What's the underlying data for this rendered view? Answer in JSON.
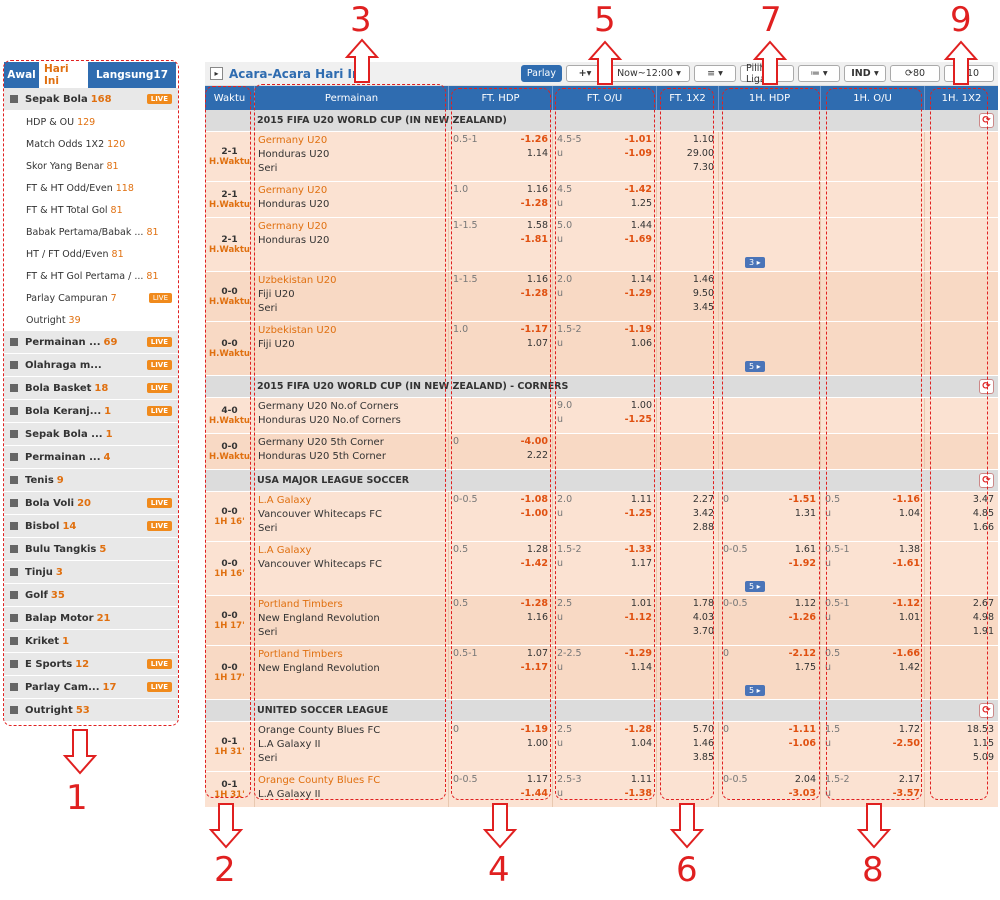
{
  "left": {
    "tabs": [
      {
        "label": "Awal",
        "active": false
      },
      {
        "label": "Hari Ini",
        "active": true
      },
      {
        "label": "Langsung",
        "count": "17",
        "active": false
      }
    ],
    "sports": [
      {
        "label": "Sepak Bola",
        "count": "168",
        "live": true,
        "subs": [
          {
            "label": "HDP & OU",
            "count": "129"
          },
          {
            "label": "Match Odds 1X2",
            "count": "120"
          },
          {
            "label": "Skor Yang Benar",
            "count": "81"
          },
          {
            "label": "FT & HT Odd/Even",
            "count": "118"
          },
          {
            "label": "FT & HT Total Gol",
            "count": "81"
          },
          {
            "label": "Babak Pertama/Babak ...",
            "count": "81"
          },
          {
            "label": "HT / FT Odd/Even",
            "count": "81"
          },
          {
            "label": "FT & HT Gol Pertama / ...",
            "count": "81"
          },
          {
            "label": "Parlay Campuran",
            "count": "7",
            "live": true
          },
          {
            "label": "Outright",
            "count": "39"
          }
        ]
      },
      {
        "label": "Permainan ...",
        "count": "69",
        "live": true
      },
      {
        "label": "Olahraga m...",
        "count": "",
        "live": true
      },
      {
        "label": "Bola Basket",
        "count": "18",
        "live": true
      },
      {
        "label": "Bola Keranj...",
        "count": "1",
        "live": true
      },
      {
        "label": "Sepak Bola ...",
        "count": "1"
      },
      {
        "label": "Permainan ...",
        "count": "4"
      },
      {
        "label": "Tenis",
        "count": "9"
      },
      {
        "label": "Bola Voli",
        "count": "20",
        "live": true
      },
      {
        "label": "Bisbol",
        "count": "14",
        "live": true
      },
      {
        "label": "Bulu Tangkis",
        "count": "5"
      },
      {
        "label": "Tinju",
        "count": "3"
      },
      {
        "label": "Golf",
        "count": "35"
      },
      {
        "label": "Balap Motor",
        "count": "21"
      },
      {
        "label": "Kriket",
        "count": "1"
      },
      {
        "label": "E Sports",
        "count": "12",
        "live": true
      },
      {
        "label": "Parlay Cam...",
        "count": "17",
        "live": true
      },
      {
        "label": "Outright",
        "count": "53"
      }
    ],
    "live_label": "LIVE"
  },
  "main": {
    "title": "Acara-Acara Hari Ini",
    "toolbar": {
      "parlay": "Parlay",
      "add": "+",
      "time": "Now~12:00",
      "sort": "≡",
      "pick_league": "Pilih Liga",
      "view": "≔",
      "odds_type": "IND",
      "refresh_a": "80",
      "refresh_b": "10"
    },
    "headers": [
      "Waktu",
      "Permainan",
      "FT. HDP",
      "FT. O/U",
      "FT. 1X2",
      "1H. HDP",
      "1H. O/U",
      "1H. 1X2"
    ],
    "leagues": [
      {
        "name": "2015 FIFA U20 WORLD CUP (IN NEW ZEALAND)",
        "matches": [
          {
            "alt": false,
            "score": "2-1",
            "time": "H.Waktu",
            "teams": [
              "Germany U20",
              "Honduras U20",
              "Seri"
            ],
            "fav": 0,
            "fthdp": [
              [
                "0.5-1",
                "-1.26"
              ],
              [
                "",
                "1.14"
              ]
            ],
            "ftou": [
              [
                "4.5-5",
                "-1.01"
              ],
              [
                "u",
                "-1.09"
              ]
            ],
            "ft1x2": [
              "1.10",
              "29.00",
              "7.30"
            ]
          },
          {
            "alt": false,
            "score": "2-1",
            "time": "H.Waktu",
            "teams": [
              "Germany U20",
              "Honduras U20"
            ],
            "fav": 0,
            "fthdp": [
              [
                "1.0",
                "1.16"
              ],
              [
                "",
                "-1.28"
              ]
            ],
            "ftou": [
              [
                "4.5",
                "-1.42"
              ],
              [
                "u",
                "1.25"
              ]
            ]
          },
          {
            "alt": false,
            "score": "2-1",
            "time": "H.Waktu",
            "teams": [
              "Germany U20",
              "Honduras U20"
            ],
            "fav": 0,
            "fthdp": [
              [
                "1-1.5",
                "1.58"
              ],
              [
                "",
                "-1.81"
              ]
            ],
            "ftou": [
              [
                "5.0",
                "1.44"
              ],
              [
                "u",
                "-1.69"
              ]
            ],
            "more": "3"
          },
          {
            "alt": true,
            "score": "0-0",
            "time": "H.Waktu",
            "teams": [
              "Uzbekistan U20",
              "Fiji U20",
              "Seri"
            ],
            "fav": 0,
            "fthdp": [
              [
                "1-1.5",
                "1.16"
              ],
              [
                "",
                "-1.28"
              ]
            ],
            "ftou": [
              [
                "2.0",
                "1.14"
              ],
              [
                "u",
                "-1.29"
              ]
            ],
            "ft1x2": [
              "1.46",
              "9.50",
              "3.45"
            ]
          },
          {
            "alt": true,
            "score": "0-0",
            "time": "H.Waktu",
            "teams": [
              "Uzbekistan U20",
              "Fiji U20"
            ],
            "fav": 0,
            "fthdp": [
              [
                "1.0",
                "-1.17"
              ],
              [
                "",
                "1.07"
              ]
            ],
            "ftou": [
              [
                "1.5-2",
                "-1.19"
              ],
              [
                "u",
                "1.06"
              ]
            ],
            "more": "5"
          }
        ]
      },
      {
        "name": "2015 FIFA U20 WORLD CUP (IN NEW ZEALAND) - CORNERS",
        "matches": [
          {
            "alt": false,
            "score": "4-0",
            "time": "H.Waktu",
            "teams": [
              "Germany U20 No.of Corners",
              "Honduras U20 No.of Corners"
            ],
            "fav": -1,
            "fthdp": [],
            "ftou": [
              [
                "9.0",
                "1.00"
              ],
              [
                "u",
                "-1.25"
              ]
            ]
          },
          {
            "alt": true,
            "score": "0-0",
            "time": "H.Waktu",
            "teams": [
              "Germany U20 5th Corner",
              "Honduras U20 5th Corner"
            ],
            "fav": -1,
            "fthdp": [
              [
                "0",
                "-4.00"
              ],
              [
                "",
                "2.22"
              ]
            ],
            "ftou": []
          }
        ]
      },
      {
        "name": "USA MAJOR LEAGUE SOCCER",
        "matches": [
          {
            "alt": false,
            "score": "0-0",
            "time": "1H 16'",
            "teams": [
              "L.A Galaxy",
              "Vancouver Whitecaps FC",
              "Seri"
            ],
            "fav": 0,
            "fthdp": [
              [
                "0-0.5",
                "-1.08"
              ],
              [
                "",
                "-1.00"
              ]
            ],
            "ftou": [
              [
                "2.0",
                "1.11"
              ],
              [
                "u",
                "-1.25"
              ]
            ],
            "ft1x2": [
              "2.27",
              "3.42",
              "2.88"
            ],
            "hhdp": [
              [
                "0",
                "-1.51"
              ],
              [
                "",
                "1.31"
              ]
            ],
            "hou": [
              [
                "0.5",
                "-1.16"
              ],
              [
                "u",
                "1.04"
              ]
            ],
            "h1x2": [
              "3.47",
              "4.85",
              "1.66"
            ]
          },
          {
            "alt": false,
            "score": "0-0",
            "time": "1H 16'",
            "teams": [
              "L.A Galaxy",
              "Vancouver Whitecaps FC"
            ],
            "fav": 0,
            "fthdp": [
              [
                "0.5",
                "1.28"
              ],
              [
                "",
                "-1.42"
              ]
            ],
            "ftou": [
              [
                "1.5-2",
                "-1.33"
              ],
              [
                "u",
                "1.17"
              ]
            ],
            "hhdp": [
              [
                "0-0.5",
                "1.61"
              ],
              [
                "",
                "-1.92"
              ]
            ],
            "hou": [
              [
                "0.5-1",
                "1.38"
              ],
              [
                "u",
                "-1.61"
              ]
            ],
            "more": "5"
          },
          {
            "alt": true,
            "score": "0-0",
            "time": "1H 17'",
            "teams": [
              "Portland Timbers",
              "New England Revolution",
              "Seri"
            ],
            "fav": 0,
            "fthdp": [
              [
                "0.5",
                "-1.28"
              ],
              [
                "",
                "1.16"
              ]
            ],
            "ftou": [
              [
                "2.5",
                "1.01"
              ],
              [
                "u",
                "-1.12"
              ]
            ],
            "ft1x2": [
              "1.78",
              "4.03",
              "3.70"
            ],
            "hhdp": [
              [
                "0-0.5",
                "1.12"
              ],
              [
                "",
                "-1.26"
              ]
            ],
            "hou": [
              [
                "0.5-1",
                "-1.12"
              ],
              [
                "u",
                "1.01"
              ]
            ],
            "h1x2": [
              "2.67",
              "4.98",
              "1.91"
            ]
          },
          {
            "alt": true,
            "score": "0-0",
            "time": "1H 17'",
            "teams": [
              "Portland Timbers",
              "New England Revolution"
            ],
            "fav": 0,
            "fthdp": [
              [
                "0.5-1",
                "1.07"
              ],
              [
                "",
                "-1.17"
              ]
            ],
            "ftou": [
              [
                "2-2.5",
                "-1.29"
              ],
              [
                "u",
                "1.14"
              ]
            ],
            "hhdp": [
              [
                "0",
                "-2.12"
              ],
              [
                "",
                "1.75"
              ]
            ],
            "hou": [
              [
                "0.5",
                "-1.66"
              ],
              [
                "u",
                "1.42"
              ]
            ],
            "more": "5"
          }
        ]
      },
      {
        "name": "UNITED SOCCER LEAGUE",
        "matches": [
          {
            "alt": false,
            "score": "0-1",
            "time": "1H 31'",
            "teams": [
              "Orange County Blues FC",
              "L.A Galaxy II",
              "Seri"
            ],
            "fav": -1,
            "fthdp": [
              [
                "0",
                "-1.19"
              ],
              [
                "",
                "1.00"
              ]
            ],
            "ftou": [
              [
                "2.5",
                "-1.28"
              ],
              [
                "u",
                "1.04"
              ]
            ],
            "ft1x2": [
              "5.70",
              "1.46",
              "3.85"
            ],
            "hhdp": [
              [
                "0",
                "-1.11"
              ],
              [
                "",
                "-1.06"
              ]
            ],
            "hou": [
              [
                "1.5",
                "1.72"
              ],
              [
                "u",
                "-2.50"
              ]
            ],
            "h1x2": [
              "18.53",
              "1.15",
              "5.09"
            ]
          },
          {
            "alt": false,
            "score": "0-1",
            "time": "1H 31'",
            "teams": [
              "Orange County Blues FC",
              "L.A Galaxy II"
            ],
            "fav": 0,
            "fthdp": [
              [
                "0-0.5",
                "1.17"
              ],
              [
                "",
                "-1.44"
              ]
            ],
            "ftou": [
              [
                "2.5-3",
                "1.11"
              ],
              [
                "u",
                "-1.38"
              ]
            ],
            "hhdp": [
              [
                "0-0.5",
                "2.04"
              ],
              [
                "",
                "-3.03"
              ]
            ],
            "hou": [
              [
                "1.5-2",
                "2.17"
              ],
              [
                "u",
                "-3.57"
              ]
            ]
          }
        ]
      }
    ]
  },
  "annotations": [
    "1",
    "2",
    "3",
    "4",
    "5",
    "6",
    "7",
    "8",
    "9"
  ],
  "colors": {
    "accent": "#2f6cb0",
    "odds_neg": "#e05010",
    "annotation": "#e02020",
    "row_bg": "#fbe2d2"
  }
}
